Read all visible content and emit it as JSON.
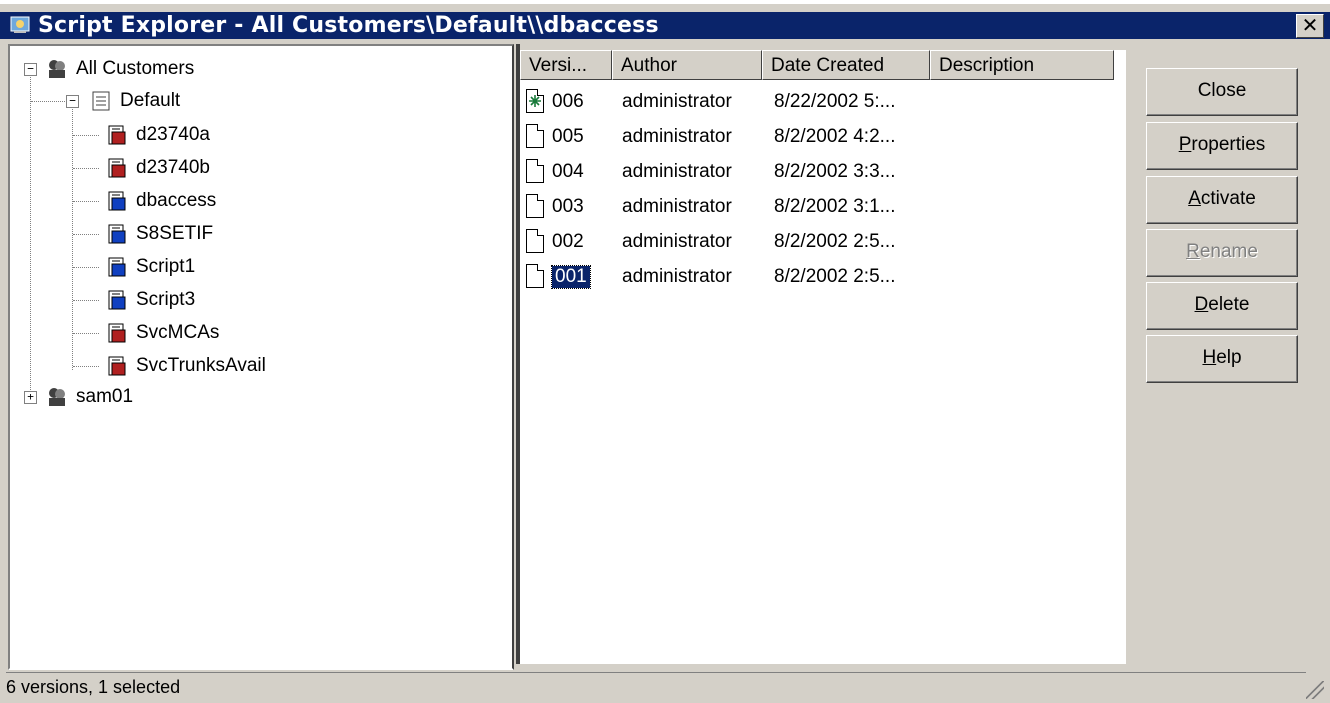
{
  "window": {
    "title": "Script Explorer - All Customers\\Default\\\\dbaccess",
    "close_glyph": "✕"
  },
  "tree": {
    "root": {
      "label": "All Customers",
      "icon": "customers-icon",
      "expanded": true
    },
    "default": {
      "label": "Default",
      "icon": "folder-doc-icon",
      "expanded": true
    },
    "scripts": [
      {
        "label": "d23740a",
        "color": "#b02020"
      },
      {
        "label": "d23740b",
        "color": "#b02020"
      },
      {
        "label": "dbaccess",
        "color": "#1040c0"
      },
      {
        "label": "S8SETIF",
        "color": "#1040c0"
      },
      {
        "label": "Script1",
        "color": "#1040c0"
      },
      {
        "label": "Script3",
        "color": "#1040c0"
      },
      {
        "label": "SvcMCAs",
        "color": "#b02020"
      },
      {
        "label": "SvcTrunksAvail",
        "color": "#b02020"
      }
    ],
    "sam": {
      "label": "sam01",
      "icon": "customers-icon",
      "expanded": false
    }
  },
  "list": {
    "columns": [
      "Versi...",
      "Author",
      "Date Created",
      "Description"
    ],
    "rows": [
      {
        "version": "006",
        "author": "administrator",
        "date": "8/22/2002 5:...",
        "description": "",
        "active": true
      },
      {
        "version": "005",
        "author": "administrator",
        "date": "8/2/2002 4:2...",
        "description": ""
      },
      {
        "version": "004",
        "author": "administrator",
        "date": "8/2/2002 3:3...",
        "description": ""
      },
      {
        "version": "003",
        "author": "administrator",
        "date": "8/2/2002 3:1...",
        "description": ""
      },
      {
        "version": "002",
        "author": "administrator",
        "date": "8/2/2002 2:5...",
        "description": ""
      },
      {
        "version": "001",
        "author": "administrator",
        "date": "8/2/2002 2:5...",
        "description": "",
        "selected": true
      }
    ]
  },
  "buttons": {
    "close": "Close",
    "properties": "Properties",
    "activate": "Activate",
    "rename": "Rename",
    "delete": "Delete",
    "help": "Help"
  },
  "status": {
    "text": "6 versions, 1 selected"
  },
  "colors": {
    "titlebar": "#0a246a",
    "face": "#d4d0c8",
    "selection": "#0a246a"
  }
}
